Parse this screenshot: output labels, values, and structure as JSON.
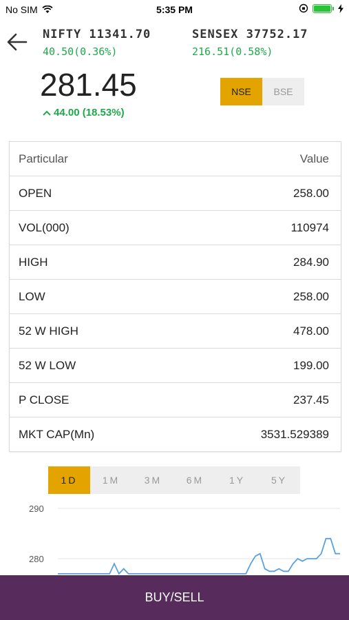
{
  "status_bar": {
    "carrier": "No SIM",
    "time": "5:35 PM"
  },
  "indices": [
    {
      "name": "NIFTY 11341.70",
      "change": "40.50(0.36%)"
    },
    {
      "name": "SENSEX 37752.17",
      "change": "216.51(0.58%)"
    }
  ],
  "stock": {
    "price": "281.45",
    "change": "44.00 (18.53%)"
  },
  "exchange": {
    "options": [
      "NSE",
      "BSE"
    ],
    "selected": "NSE"
  },
  "colors": {
    "accent": "#e4a400",
    "positive": "#1fa84a",
    "footer": "#572b5c",
    "line": "#5aa0e0"
  },
  "table": {
    "headers": [
      "Particular",
      "Value"
    ],
    "rows": [
      [
        "OPEN",
        "258.00"
      ],
      [
        "VOL(000)",
        "110974"
      ],
      [
        "HIGH",
        "284.90"
      ],
      [
        "LOW",
        "258.00"
      ],
      [
        "52 W HIGH",
        "478.00"
      ],
      [
        "52 W LOW",
        "199.00"
      ],
      [
        "P CLOSE",
        "237.45"
      ],
      [
        "MKT CAP(Mn)",
        "3531.529389"
      ]
    ]
  },
  "ranges": {
    "options": [
      "1D",
      "1M",
      "3M",
      "6M",
      "1Y",
      "5Y"
    ],
    "selected": "1D"
  },
  "chart_data": {
    "type": "line",
    "ytick_labels": [
      "290",
      "280"
    ],
    "ylim": [
      276,
      292
    ],
    "x": [
      0,
      1,
      2,
      3,
      4,
      5,
      6,
      7,
      8,
      9,
      10,
      11,
      12,
      13,
      14,
      15,
      16,
      17,
      18,
      19,
      20,
      21,
      22,
      23,
      24,
      25,
      26,
      27,
      28,
      29,
      30,
      31,
      32,
      33,
      34,
      35,
      36,
      37,
      38,
      39,
      40,
      41,
      42,
      43,
      44,
      45,
      46,
      47,
      48,
      49,
      50,
      51,
      52,
      53,
      54,
      55,
      56,
      57,
      58,
      59,
      60
    ],
    "series": [
      {
        "values": [
          277,
          277,
          277,
          277,
          277,
          277,
          277,
          277,
          277,
          277,
          277,
          277,
          279,
          277,
          278,
          277,
          277,
          277,
          277,
          277,
          277,
          277,
          277,
          277,
          277,
          277,
          277,
          277,
          277,
          277,
          277,
          277,
          277,
          277,
          277,
          277,
          277,
          277,
          277,
          277,
          277,
          279,
          280.5,
          281,
          278,
          277.5,
          277.5,
          278,
          277.5,
          277.5,
          279,
          280,
          279.5,
          280,
          280,
          280,
          281,
          284,
          284,
          281,
          281
        ]
      }
    ]
  },
  "footer": {
    "label": "BUY/SELL"
  }
}
